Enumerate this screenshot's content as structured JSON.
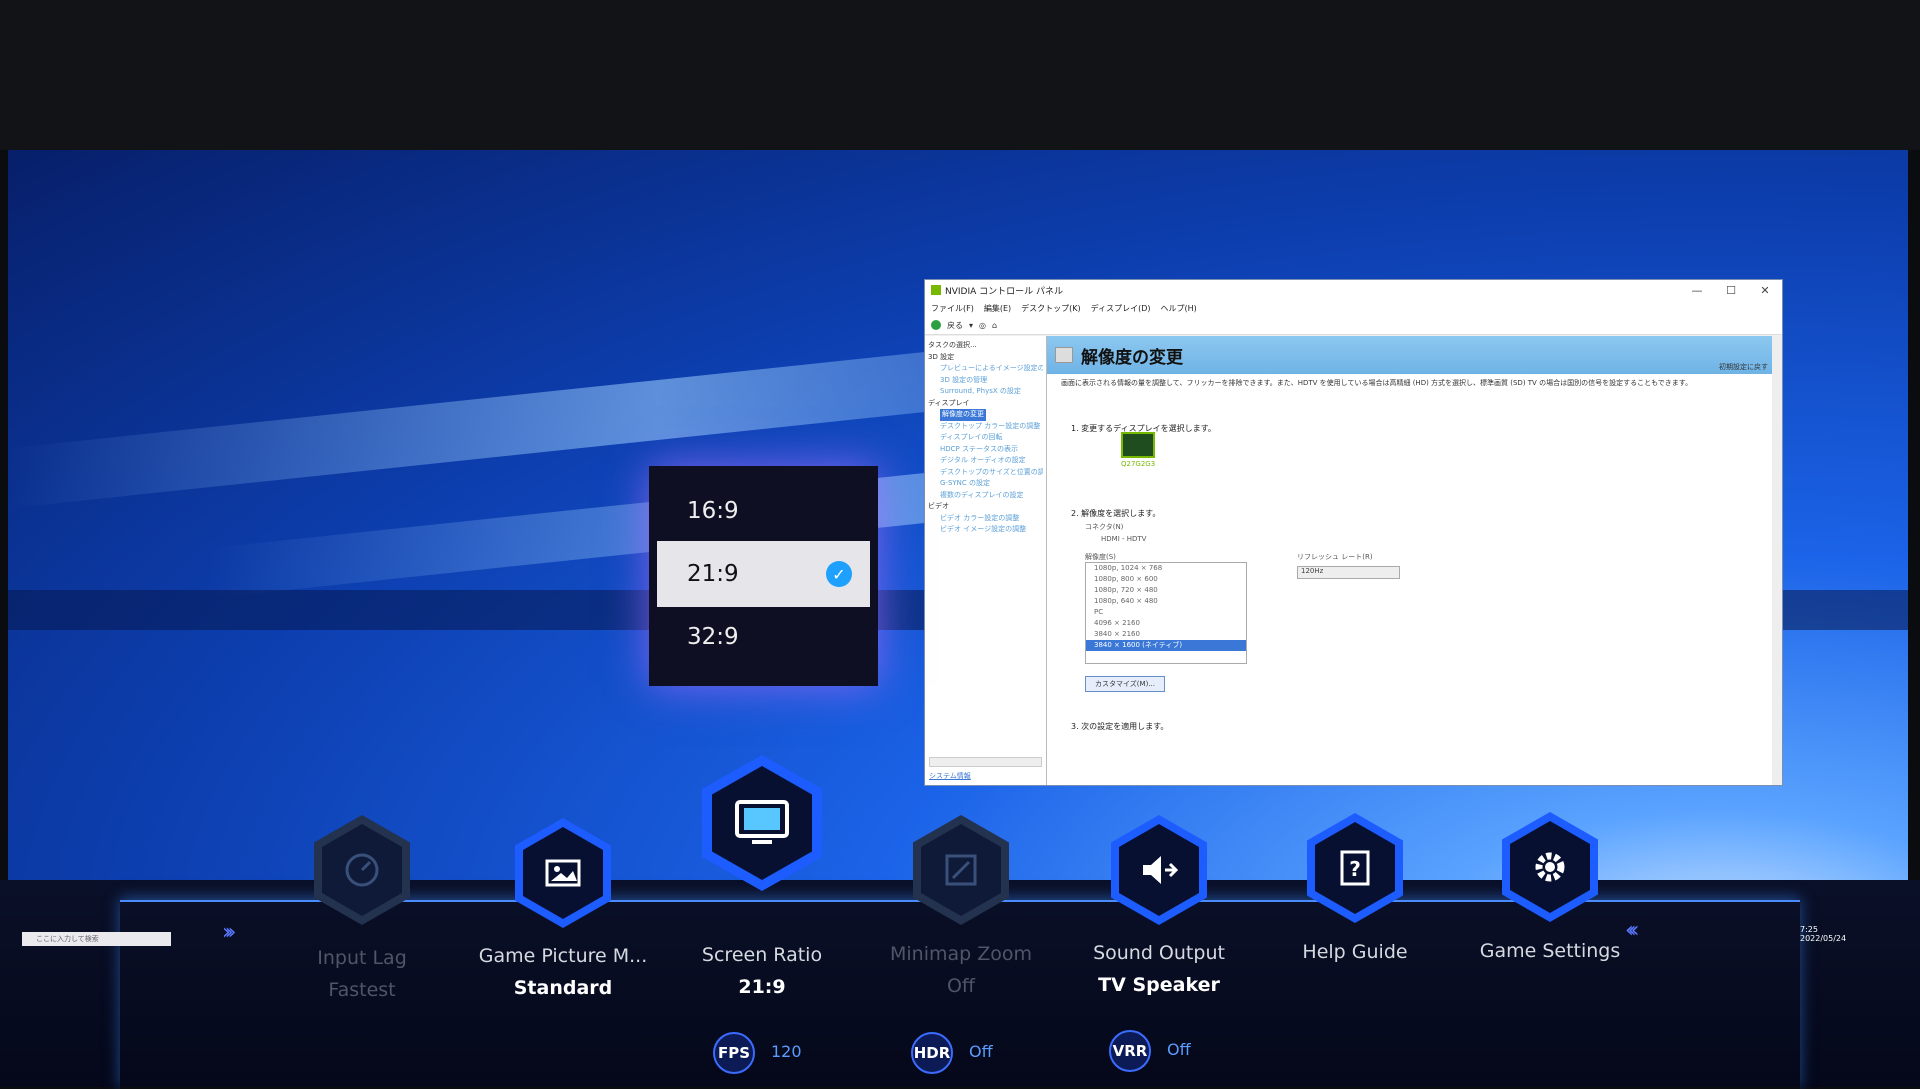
{
  "nvidia_window": {
    "title": "NVIDIA コントロール パネル",
    "controls": [
      "—",
      "☐",
      "✕"
    ],
    "menu": [
      "ファイル(F)",
      "編集(E)",
      "デスクトップ(K)",
      "ディスプレイ(D)",
      "ヘルプ(H)"
    ],
    "back_label": "戻る",
    "tree": {
      "header": "タスクの選択...",
      "items": [
        {
          "label": "3D 設定",
          "level": 0
        },
        {
          "label": "プレビューによるイメージ設定の調整",
          "level": 1
        },
        {
          "label": "3D 設定の管理",
          "level": 1
        },
        {
          "label": "Surround, PhysX の設定",
          "level": 1
        },
        {
          "label": "ディスプレイ",
          "level": 0
        },
        {
          "label": "解像度の変更",
          "level": 1,
          "selected": true
        },
        {
          "label": "デスクトップ カラー設定の調整",
          "level": 1
        },
        {
          "label": "ディスプレイの回転",
          "level": 1
        },
        {
          "label": "HDCP ステータスの表示",
          "level": 1
        },
        {
          "label": "デジタル オーディオの設定",
          "level": 1
        },
        {
          "label": "デスクトップのサイズと位置の調整",
          "level": 1
        },
        {
          "label": "G-SYNC の設定",
          "level": 1
        },
        {
          "label": "複数のディスプレイの設定",
          "level": 1
        },
        {
          "label": "ビデオ",
          "level": 0
        },
        {
          "label": "ビデオ カラー設定の調整",
          "level": 1
        },
        {
          "label": "ビデオ イメージ設定の調整",
          "level": 1
        }
      ],
      "system_info": "システム情報"
    },
    "page_title": "解像度の変更",
    "restore_defaults": "初期設定に戻す",
    "description": "画面に表示される情報の量を調整して、フリッカーを排除できます。また、HDTV を使用している場合は高精細 (HD) 方式を選択し、標準画質 (SD) TV の場合は国別の信号を設定することもできます。",
    "step1": "1. 変更するディスプレイを選択します。",
    "monitor_name": "Q27G2G3",
    "step2": "2. 解像度を選択します。",
    "connector_label": "コネクタ(N)",
    "connector_value": "HDMI - HDTV",
    "resolution_label": "解像度(S)",
    "refresh_label": "リフレッシュ レート(R)",
    "refresh_value": "120Hz",
    "resolutions": [
      "1080p, 1024 × 768",
      "1080p, 800 × 600",
      "1080p, 720 × 480",
      "1080p, 640 × 480",
      "PC",
      "4096 × 2160",
      "3840 × 2160",
      "3840 × 1600 (ネイティブ)"
    ],
    "customize_button": "カスタマイズ(M)...",
    "step3": "3. 次の設定を適用します。"
  },
  "ratio_popup": {
    "options": [
      {
        "label": "16:9",
        "selected": false
      },
      {
        "label": "21:9",
        "selected": true
      },
      {
        "label": "32:9",
        "selected": false
      }
    ]
  },
  "game_bar": {
    "items": [
      {
        "label": "Input Lag",
        "value": "Fastest",
        "icon": "speedometer-icon",
        "enabled": false
      },
      {
        "label": "Game Picture M...",
        "value": "Standard",
        "icon": "picture-icon",
        "enabled": true
      },
      {
        "label": "Screen Ratio",
        "value": "21:9",
        "icon": "screen-icon",
        "enabled": true,
        "selected": true
      },
      {
        "label": "Minimap Zoom",
        "value": "Off",
        "icon": "zoom-icon",
        "enabled": false
      },
      {
        "label": "Sound Output",
        "value": "TV Speaker",
        "icon": "speaker-icon",
        "enabled": true
      },
      {
        "label": "Help Guide",
        "value": "",
        "icon": "help-book-icon",
        "enabled": true
      },
      {
        "label": "Game Settings",
        "value": "",
        "icon": "gear-icon",
        "enabled": true
      }
    ],
    "status": [
      {
        "badge": "FPS",
        "value": "120"
      },
      {
        "badge": "HDR",
        "value": "Off"
      },
      {
        "badge": "VRR",
        "value": "Off"
      }
    ]
  },
  "taskbar": {
    "search_placeholder": "ここに入力して検索",
    "time": "7:25",
    "date": "2022/05/24"
  },
  "colors": {
    "accent": "#1d5cff",
    "check": "#1ea0ff",
    "nvidia_green": "#76b900"
  }
}
